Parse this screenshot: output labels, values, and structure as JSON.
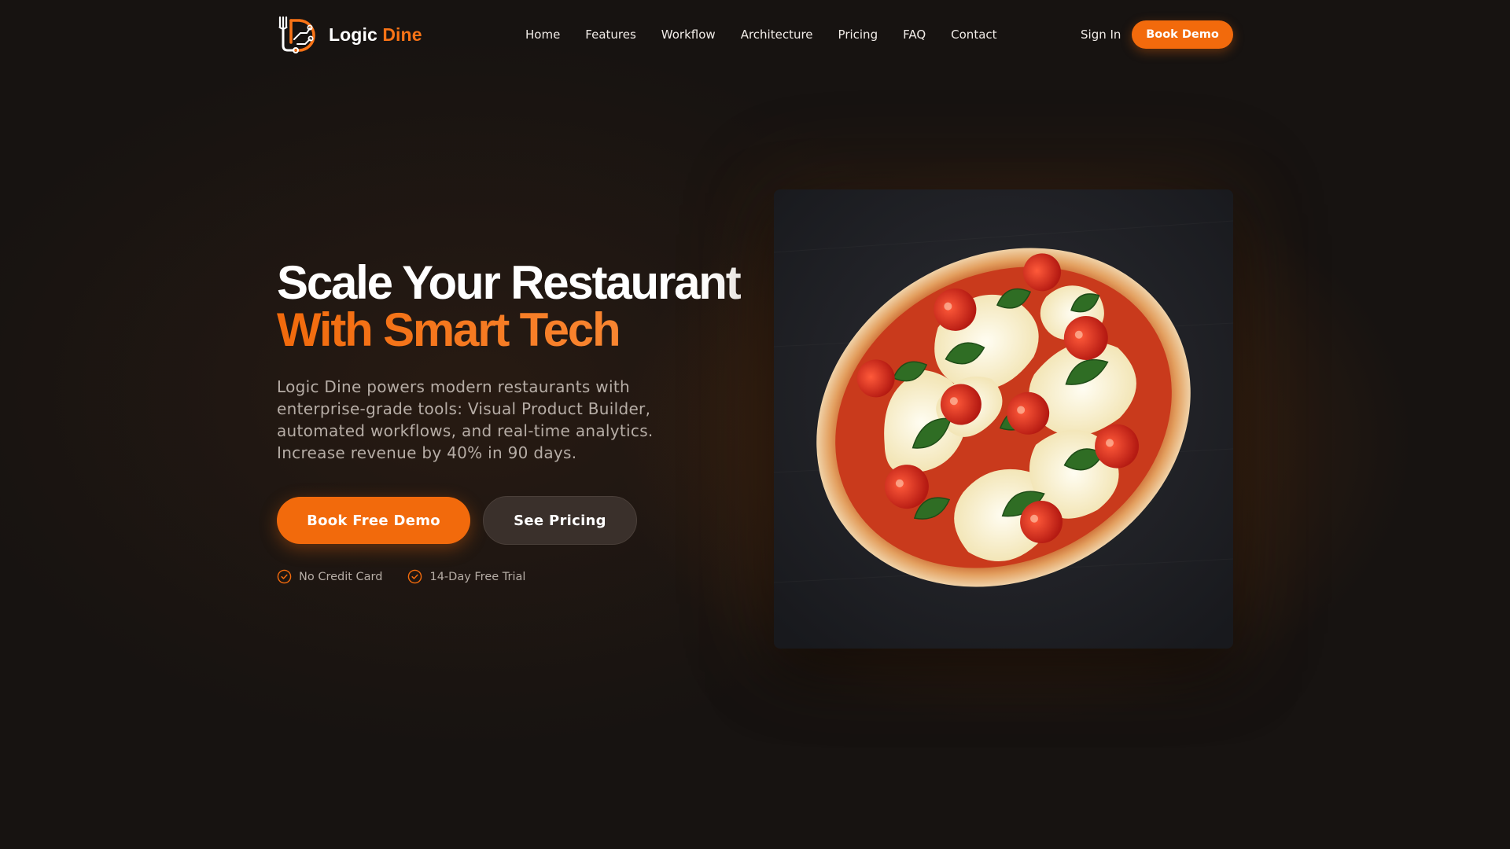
{
  "brand": {
    "name_part1": "Logic",
    "name_part2": "Dine",
    "accent_color": "#f26a0c",
    "logo_icon": "fork-circuit-logo-icon"
  },
  "nav": {
    "links": [
      "Home",
      "Features",
      "Workflow",
      "Architecture",
      "Pricing",
      "FAQ",
      "Contact"
    ],
    "signin_label": "Sign In",
    "cta_label": "Book Demo"
  },
  "hero": {
    "title_line1": "Scale Your Restaurant",
    "title_line2": "With Smart Tech",
    "description": "Logic Dine powers modern restaurants with enterprise-grade tools: Visual Product Builder, automated workflows, and real-time analytics. Increase revenue by 40% in 90 days.",
    "primary_button": "Book Free Demo",
    "secondary_button": "See Pricing",
    "perks": [
      "No Credit Card",
      "14-Day Free Trial"
    ],
    "perk_icon": "check-circle-icon",
    "image_subject": "margherita-pizza-image"
  },
  "colors": {
    "background": "#171311",
    "muted_text": "#b6ada6",
    "secondary_button_bg": "#3a302b"
  }
}
